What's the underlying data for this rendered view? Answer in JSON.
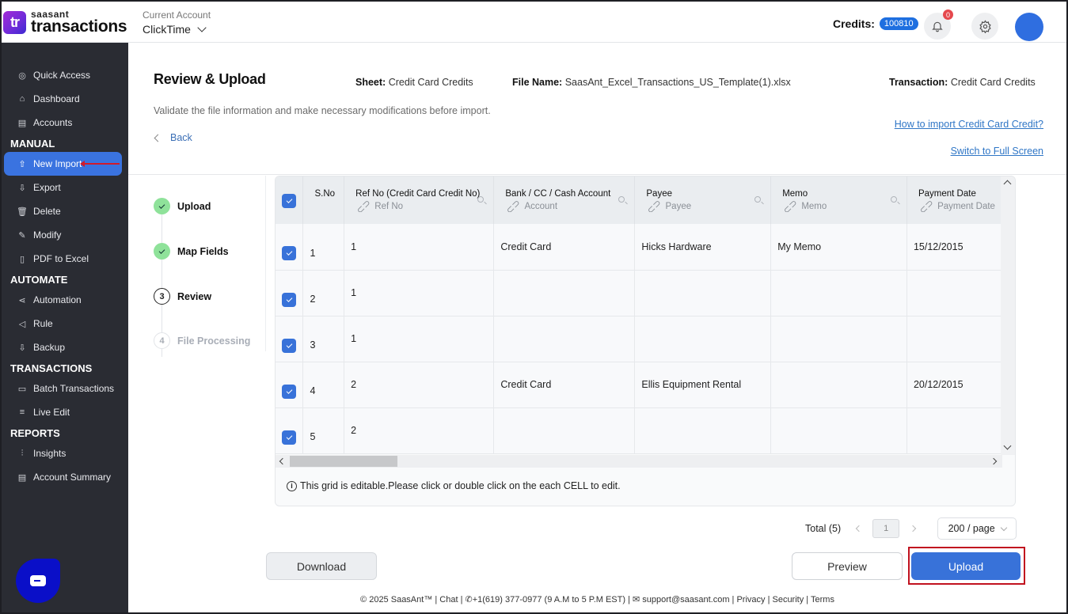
{
  "header": {
    "logo_small": "saasant",
    "logo_big": "transactions",
    "logo_badge": "tr",
    "account_label": "Current Account",
    "account_value": "ClickTime",
    "credits_label": "Credits:",
    "credits_value": "100810",
    "notification_count": "0"
  },
  "sidebar": {
    "top_items": [
      {
        "label": "Quick Access",
        "icon": "target-icon"
      },
      {
        "label": "Dashboard",
        "icon": "home-icon"
      },
      {
        "label": "Accounts",
        "icon": "clipboard-icon"
      }
    ],
    "sections": [
      {
        "title": "MANUAL",
        "items": [
          {
            "label": "New Import",
            "icon": "upload-cloud-icon",
            "active": true
          },
          {
            "label": "Export",
            "icon": "download-cloud-icon"
          },
          {
            "label": "Delete",
            "icon": "trash-icon"
          },
          {
            "label": "Modify",
            "icon": "edit-file-icon"
          },
          {
            "label": "PDF to Excel",
            "icon": "pdf-icon"
          }
        ]
      },
      {
        "title": "AUTOMATE",
        "items": [
          {
            "label": "Automation",
            "icon": "share-nodes-icon"
          },
          {
            "label": "Rule",
            "icon": "megaphone-icon"
          },
          {
            "label": "Backup",
            "icon": "download-cloud-icon"
          }
        ]
      },
      {
        "title": "TRANSACTIONS",
        "items": [
          {
            "label": "Batch Transactions",
            "icon": "document-icon"
          },
          {
            "label": "Live Edit",
            "icon": "live-edit-icon"
          }
        ]
      },
      {
        "title": "REPORTS",
        "items": [
          {
            "label": "Insights",
            "icon": "sliders-icon"
          },
          {
            "label": "Account Summary",
            "icon": "clipboard-icon"
          }
        ]
      }
    ]
  },
  "page": {
    "title": "Review & Upload",
    "sheet_label": "Sheet:",
    "sheet_value": "Credit Card Credits",
    "file_label": "File Name:",
    "file_value": "SaasAnt_Excel_Transactions_US_Template(1).xlsx",
    "transaction_label": "Transaction:",
    "transaction_value": "Credit Card Credits",
    "subtitle": "Validate the file information and make necessary modifications before import.",
    "back_label": "Back",
    "help_link": "How to import Credit Card Credit?",
    "fullscreen_link": "Switch to Full Screen"
  },
  "stepper": [
    {
      "label": "Upload",
      "state": "done",
      "num": "1"
    },
    {
      "label": "Map Fields",
      "state": "done",
      "num": "2"
    },
    {
      "label": "Review",
      "state": "current",
      "num": "3"
    },
    {
      "label": "File Processing",
      "state": "pending",
      "num": "4"
    }
  ],
  "grid": {
    "columns": [
      {
        "title": "S.No",
        "mapped": ""
      },
      {
        "title": "Ref No (Credit Card Credit No)",
        "mapped": "Ref No"
      },
      {
        "title": "Bank / CC / Cash Account",
        "mapped": "Account"
      },
      {
        "title": "Payee",
        "mapped": "Payee"
      },
      {
        "title": "Memo",
        "mapped": "Memo"
      },
      {
        "title": "Payment Date",
        "mapped": "Payment Date"
      }
    ],
    "rows": [
      {
        "sno": "1",
        "ref": "1",
        "account": "Credit Card",
        "payee": "Hicks Hardware",
        "memo": "My Memo",
        "date": "15/12/2015",
        "checked": true
      },
      {
        "sno": "2",
        "ref": "1",
        "account": "",
        "payee": "",
        "memo": "",
        "date": "",
        "checked": true
      },
      {
        "sno": "3",
        "ref": "1",
        "account": "",
        "payee": "",
        "memo": "",
        "date": "",
        "checked": true
      },
      {
        "sno": "4",
        "ref": "2",
        "account": "Credit Card",
        "payee": "Ellis Equipment Rental",
        "memo": "",
        "date": "20/12/2015",
        "checked": true
      },
      {
        "sno": "5",
        "ref": "2",
        "account": "",
        "payee": "",
        "memo": "",
        "date": "",
        "checked": true
      }
    ],
    "note": "This grid is editable.Please click or double click on the each CELL to edit."
  },
  "pagination": {
    "total": "Total (5)",
    "current_page": "1",
    "page_size": "200 / page"
  },
  "actions": {
    "download": "Download",
    "preview": "Preview",
    "upload": "Upload"
  },
  "footer": {
    "text": "© 2025 SaasAnt™  | Chat  |  ✆+1(619) 377-0977 (9 A.M to 5 P.M EST)  |  ✉ support@saasant.com  | Privacy  | Security  | Terms"
  }
}
